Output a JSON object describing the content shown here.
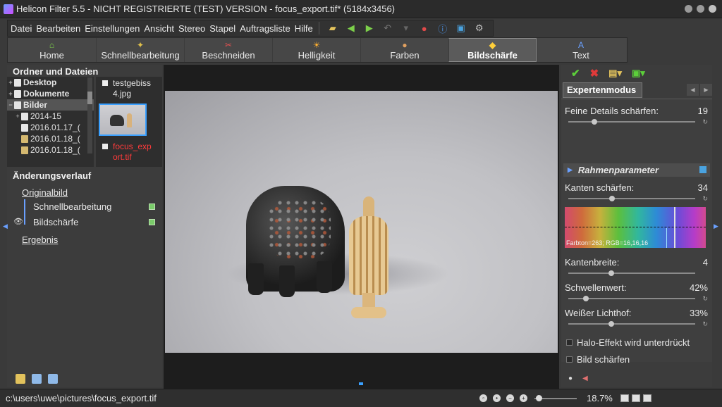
{
  "window": {
    "title": "Helicon Filter 5.5 - NICHT REGISTRIERTE (TEST) VERSION - focus_export.tif* (5184x3456)"
  },
  "menu": {
    "items": [
      "Datei",
      "Bearbeiten",
      "Einstellungen",
      "Ansicht",
      "Stereo",
      "Stapel",
      "Auftragsliste",
      "Hilfe"
    ],
    "toolbar_icons": [
      "folder-open-icon",
      "back-arrow-icon",
      "forward-arrow-icon",
      "undo-icon",
      "crop-dropdown-icon",
      "location-pin-icon",
      "info-icon",
      "monitor-icon",
      "settings-icon"
    ]
  },
  "tabs": [
    {
      "label": "Home",
      "icon": "home-icon"
    },
    {
      "label": "Schnellbearbeitung",
      "icon": "magic-wand-icon"
    },
    {
      "label": "Beschneiden",
      "icon": "scissors-icon"
    },
    {
      "label": "Helligkeit",
      "icon": "sun-icon"
    },
    {
      "label": "Farben",
      "icon": "palette-icon"
    },
    {
      "label": "Bildschärfe",
      "icon": "sharpen-icon",
      "active": true
    },
    {
      "label": "Text",
      "icon": "text-icon"
    }
  ],
  "left_panel": {
    "folders_title": "Ordner und Dateien",
    "tree": [
      {
        "label": "Desktop",
        "exp": "+",
        "bold": true
      },
      {
        "label": "Dokumente",
        "exp": "+",
        "bold": true
      },
      {
        "label": "Bilder",
        "exp": "−",
        "bold": true,
        "selected": true
      },
      {
        "label": "2014-15",
        "exp": "+"
      },
      {
        "label": "2016.01.17_(",
        "exp": ""
      },
      {
        "label": "2016.01.18_(",
        "exp": ""
      },
      {
        "label": "2016.01.18_(",
        "exp": ""
      }
    ],
    "files": [
      {
        "name": "testgebiss4.jpg",
        "unsaved": false
      },
      {
        "name": "focus_export.tif",
        "unsaved": true
      }
    ],
    "history_title": "Änderungsverlauf",
    "history": {
      "original": "Originalbild",
      "steps": [
        "Schnellbearbeitung",
        "Bildschärfe"
      ],
      "result": "Ergebnis"
    }
  },
  "right_panel": {
    "mode_tab": "Expertenmodus",
    "params": {
      "fine_details": {
        "label": "Feine Details schärfen:",
        "value": "19",
        "level": 0.19
      },
      "section": "Rahmenparameter",
      "edges": {
        "label": "Kanten schärfen:",
        "value": "34",
        "level": 0.34
      },
      "spectrum_info": "Farbton=263; RGB=16,16,16",
      "edge_width": {
        "label": "Kantenbreite:",
        "value": "4",
        "level": 0.33
      },
      "threshold": {
        "label": "Schwellenwert:",
        "value": "42%",
        "level": 0.12
      },
      "white_halo": {
        "label": "Weißer Lichthof:",
        "value": "33%",
        "level": 0.33
      }
    },
    "checkboxes": [
      "Halo-Effekt wird unterdrückt",
      "Bild schärfen"
    ]
  },
  "status": {
    "path": "c:\\users\\uwe\\pictures\\focus_export.tif",
    "zoom": "18.7%"
  }
}
